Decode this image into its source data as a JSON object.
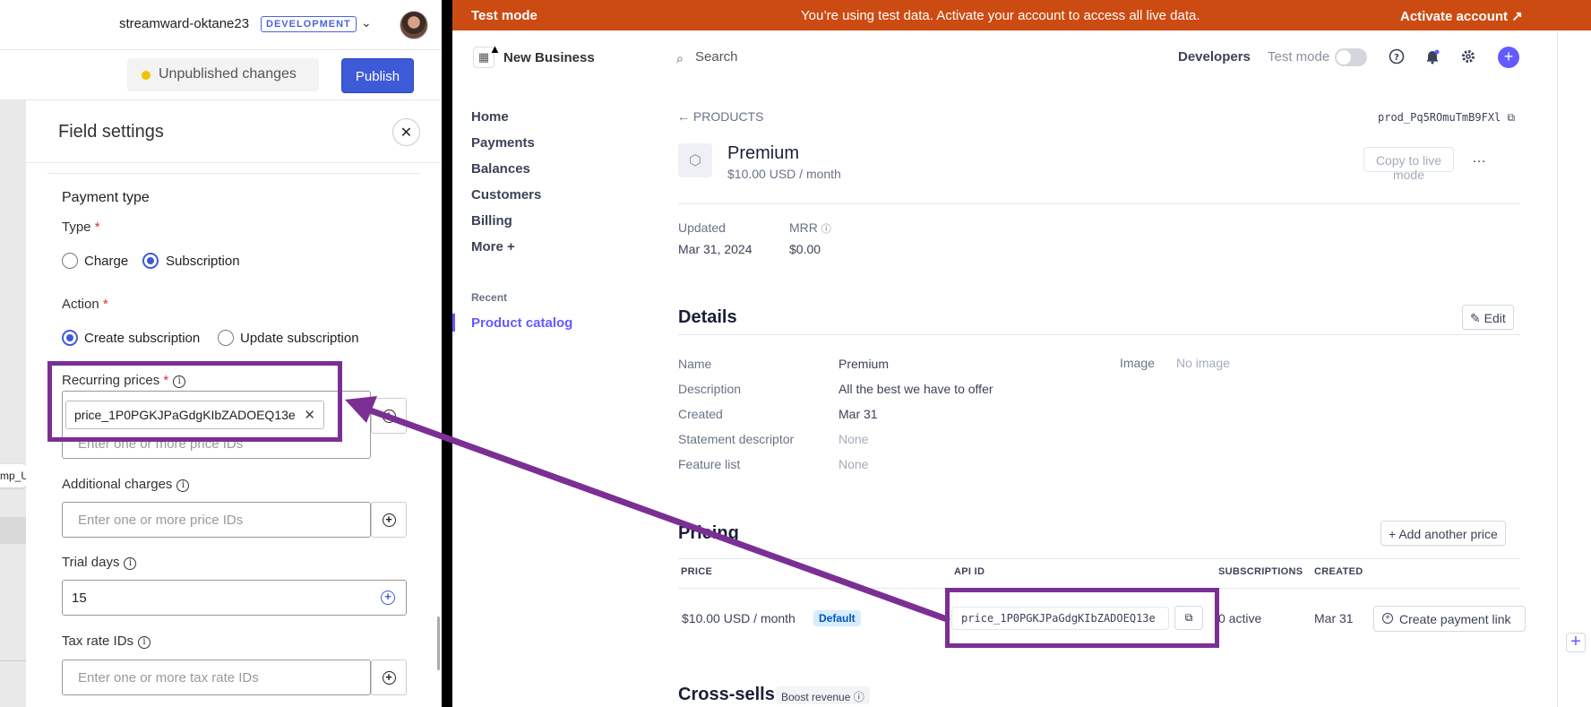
{
  "left_panel": {
    "account_name": "streamward-oktane23",
    "env_badge": "DEVELOPMENT",
    "unpublished": "Unpublished changes",
    "publish": "Publish",
    "side_snippet": "mp_U",
    "field_settings": {
      "title": "Field settings",
      "close_glyph": "✕",
      "payment_type_heading": "Payment type",
      "type_label": "Type",
      "required_mark": "*",
      "type_options": [
        "Charge",
        "Subscription"
      ],
      "type_selected": "Subscription",
      "action_label": "Action",
      "action_options": [
        "Create subscription",
        "Update subscription"
      ],
      "action_selected": "Create subscription",
      "recurring_prices_label": "Recurring prices",
      "recurring_price_chip": "price_1P0PGKJPaGdgKIbZADOEQ13e",
      "recurring_placeholder": "Enter one or more price IDs",
      "additional_charges_label": "Additional charges",
      "additional_charges_placeholder": "Enter one or more price IDs",
      "trial_days_label": "Trial days",
      "trial_days_value": "15",
      "tax_rate_label": "Tax rate IDs",
      "tax_rate_placeholder": "Enter one or more tax rate IDs"
    }
  },
  "stripe": {
    "banner": {
      "left": "Test mode",
      "center": "You’re using test data. Activate your account to access all live data.",
      "right": "Activate account ↗"
    },
    "business_name": "New Business",
    "nav": [
      "Home",
      "Payments",
      "Balances",
      "Customers",
      "Billing",
      "More +"
    ],
    "recent_label": "Recent",
    "recent_item": "Product catalog",
    "search_placeholder": "Search",
    "developers": "Developers",
    "test_mode_label": "Test mode",
    "test_mode_on": false,
    "icons": [
      "help-icon",
      "bell-icon",
      "gear-icon",
      "plus-icon"
    ],
    "accent_color": "#635bff",
    "product": {
      "breadcrumb": "← PRODUCTS",
      "id": "prod_Pq5ROmuTmB9FXl",
      "name": "Premium",
      "price": "$10.00 USD / month",
      "copy_to_live": "Copy to live mode",
      "more": "…",
      "updated_label": "Updated",
      "updated_value": "Mar 31, 2024",
      "mrr_label": "MRR",
      "mrr_value": "$0.00"
    },
    "details": {
      "heading": "Details",
      "edit": "Edit",
      "rows": [
        {
          "k": "Name",
          "v": "Premium"
        },
        {
          "k": "Description",
          "v": "All the best we have to offer"
        },
        {
          "k": "Created",
          "v": "Mar 31"
        },
        {
          "k": "Statement descriptor",
          "v": "None"
        },
        {
          "k": "Feature list",
          "v": "None"
        }
      ],
      "image_label": "Image",
      "image_value": "No image"
    },
    "pricing": {
      "heading": "Pricing",
      "add_price": "Add another price",
      "columns": [
        "PRICE",
        "API ID",
        "SUBSCRIPTIONS",
        "CREATED"
      ],
      "row": {
        "price": "$10.00 USD / month",
        "badge": "Default",
        "api_id": "price_1P0PGKJPaGdgKIbZADOEQ13e",
        "subscriptions": "0 active",
        "created": "Mar 31",
        "action": "Create payment link"
      }
    },
    "cross_sells": {
      "heading": "Cross-sells",
      "badge": "Boost revenue"
    }
  }
}
